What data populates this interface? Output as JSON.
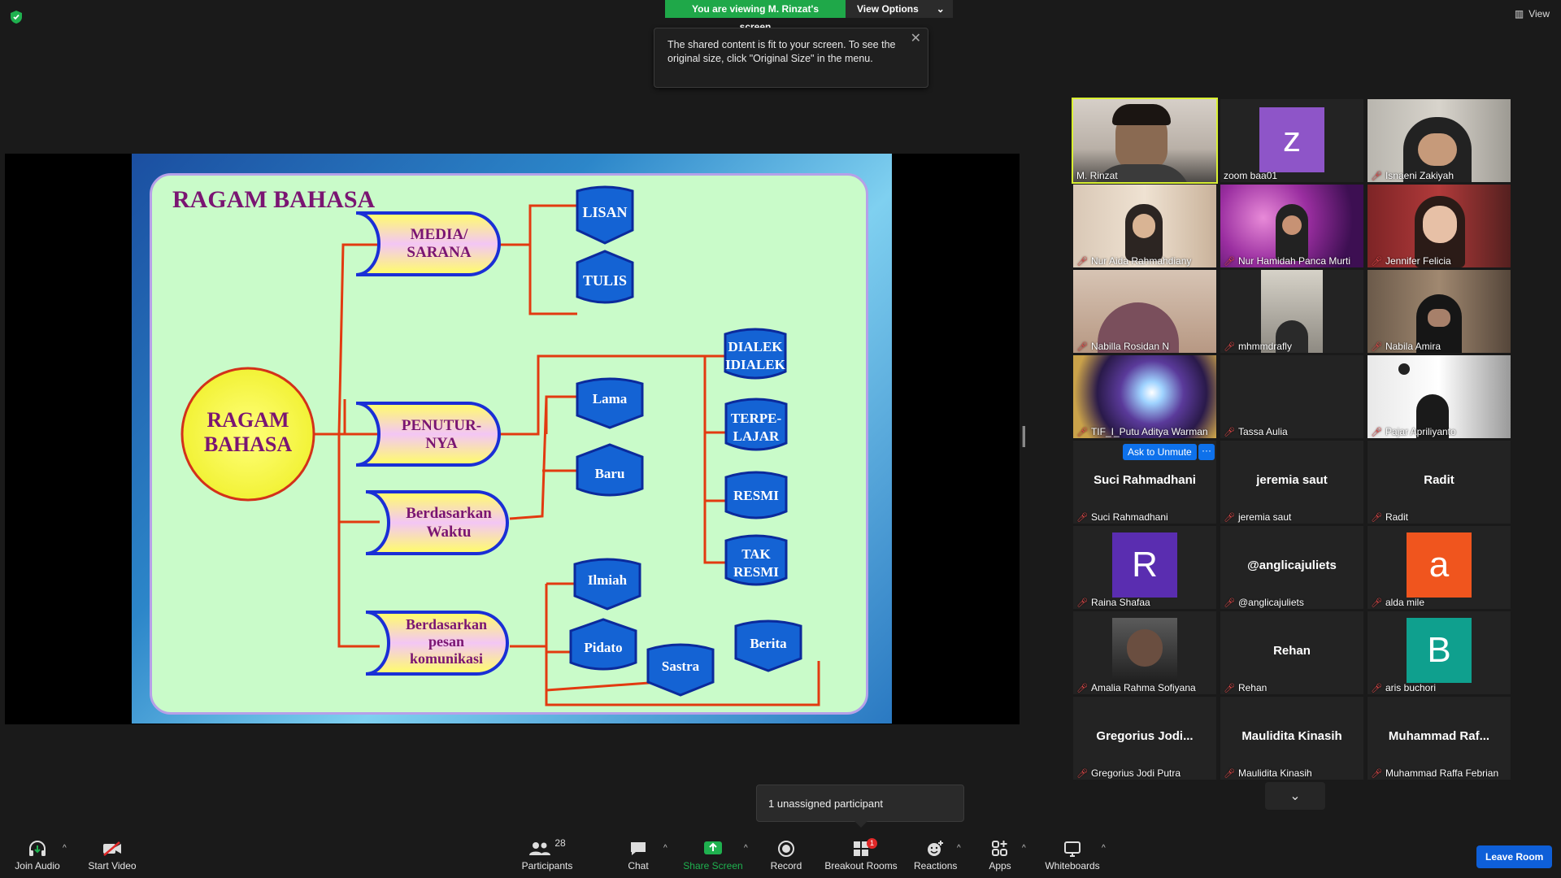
{
  "top": {
    "viewing_label": "You are viewing M. Rinzat's screen",
    "view_options": "View Options",
    "view_right": "View",
    "tooltip": "The shared content is fit to your screen. To see the original size, click \"Original Size\" in the menu."
  },
  "slide": {
    "title": "RAGAM BAHASA",
    "root": [
      "RAGAM",
      "BAHASA"
    ],
    "media": [
      "MEDIA/",
      "SARANA"
    ],
    "penutur": [
      "PENUTUR-",
      "NYA"
    ],
    "waktu": [
      "Berdasarkan",
      "Waktu"
    ],
    "pesan": [
      "Berdasarkan",
      "pesan",
      "komunikasi"
    ],
    "lisan": "LISAN",
    "tulis": "TULIS",
    "dialek": [
      "DIALEK",
      "IDIALEK"
    ],
    "terpelajar": [
      "TERPE-",
      "LAJAR"
    ],
    "resmi": "RESMI",
    "tak_resmi": [
      "TAK",
      "RESMI"
    ],
    "lama": "Lama",
    "baru": "Baru",
    "ilmiah": "Ilmiah",
    "pidato": "Pidato",
    "sastra": "Sastra",
    "berita": "Berita"
  },
  "gallery": {
    "ask_unmute": "Ask to Unmute",
    "more": "···",
    "tiles": [
      {
        "name": "M. Rinzat"
      },
      {
        "name": "zoom baa01",
        "avatar": "z"
      },
      {
        "name": "Isnaeni Zakiyah"
      },
      {
        "name": "Nur Aida Rahmahdiany"
      },
      {
        "name": "Nur Hamidah Panca Murti"
      },
      {
        "name": "Jennifer Felicia"
      },
      {
        "name": "Nabilla Rosidan N"
      },
      {
        "name": "mhmmdrafly"
      },
      {
        "name": "Nabila Amira"
      },
      {
        "name": "TIF_I_Putu Aditya Warman"
      },
      {
        "name": "Tassa Aulia"
      },
      {
        "name": "Pajar Apriliyanto"
      },
      {
        "name": "Suci Rahmadhani",
        "center": "Suci Rahmadhani"
      },
      {
        "name": "jeremia saut",
        "center": "jeremia saut"
      },
      {
        "name": "Radit",
        "center": "Radit"
      },
      {
        "name": "Raina Shafaa",
        "avatar": "R"
      },
      {
        "name": "@anglicajuliets",
        "center": "@anglicajuliets"
      },
      {
        "name": "alda mile",
        "avatar": "a"
      },
      {
        "name": "Amalia Rahma Sofiyana"
      },
      {
        "name": "Rehan",
        "center": "Rehan"
      },
      {
        "name": "aris buchori",
        "avatar": "B"
      },
      {
        "name": "Gregorius Jodi Putra",
        "center": "Gregorius  Jodi..."
      },
      {
        "name": "Maulidita Kinasih",
        "center": "Maulidita Kinasih"
      },
      {
        "name": "Muhammad Raffa Febrian",
        "center": "Muhammad  Raf..."
      }
    ]
  },
  "colors": {
    "avatar_z": "#8e55c8",
    "avatar_R": "#5a2db0",
    "avatar_a": "#f0551e",
    "avatar_B": "#0fa08e"
  },
  "unassigned": "1 unassigned participant",
  "toolbar": {
    "join_audio": "Join Audio",
    "start_video": "Start Video",
    "participants": "Participants",
    "participants_count": "28",
    "chat": "Chat",
    "share_screen": "Share Screen",
    "record": "Record",
    "breakout": "Breakout Rooms",
    "breakout_badge": "1",
    "reactions": "Reactions",
    "apps": "Apps",
    "whiteboards": "Whiteboards",
    "leave": "Leave Room"
  }
}
